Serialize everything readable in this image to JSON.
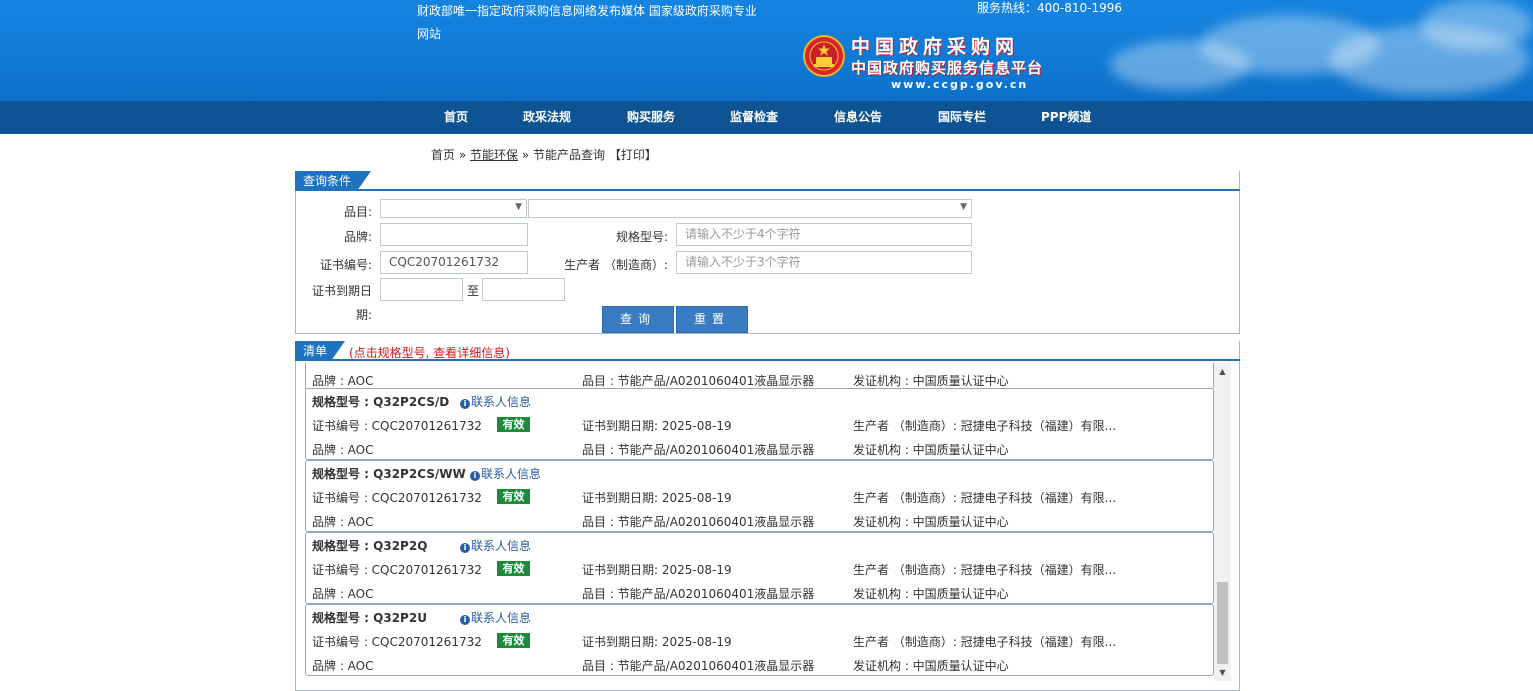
{
  "header": {
    "tagline": "财政部唯一指定政府采购信息网络发布媒体 国家级政府采购专业网站",
    "hotline": "服务热线：400-810-1996",
    "logo_cn_line1": "中国政府采购网",
    "logo_cn_line2": "中国政府购买服务信息平台",
    "logo_url": "www.ccgp.gov.cn"
  },
  "nav": {
    "items": [
      "首页",
      "政采法规",
      "购买服务",
      "监督检查",
      "信息公告",
      "国际专栏",
      "PPP频道"
    ]
  },
  "breadcrumb": {
    "home": "首页",
    "sep1": "»",
    "section": "节能环保",
    "sep2": "»",
    "page": "节能产品查询",
    "print": "【打印】"
  },
  "query": {
    "tab": "查询条件",
    "category_label": "品目:",
    "brand_label": "品牌:",
    "brand_value": "",
    "model_label": "规格型号:",
    "model_placeholder": "请输入不少于4个字符",
    "cert_label": "证书编号:",
    "cert_value": "CQC20701261732",
    "maker_label": "生产者 （制造商）:",
    "maker_placeholder": "请输入不少于3个字符",
    "expiry_label_1": "证书到期日",
    "expiry_label_2": "期:",
    "to_label": "至",
    "search_button": "查询",
    "reset_button": "重置"
  },
  "list": {
    "tab": "清单",
    "hint": "(点击规格型号, 查看详细信息)",
    "contact_label": "联系人信息",
    "partial_row": {
      "brand": "品牌 : AOC",
      "category": "品目 : 节能产品/A0201060401液晶显示器",
      "issuer": "发证机构 : 中国质量认证中心"
    },
    "items": [
      {
        "model": "规格型号 : Q32P2CS/D",
        "cert": "证书编号 : CQC20701261732",
        "status": "有效",
        "expiry": "证书到期日期: 2025-08-19",
        "maker": "生产者 （制造商）: 冠捷电子科技（福建）有限...",
        "brand": "品牌 : AOC",
        "category": "品目 : 节能产品/A0201060401液晶显示器",
        "issuer": "发证机构 : 中国质量认证中心"
      },
      {
        "model": "规格型号 : Q32P2CS/WW",
        "cert": "证书编号 : CQC20701261732",
        "status": "有效",
        "expiry": "证书到期日期: 2025-08-19",
        "maker": "生产者 （制造商）: 冠捷电子科技（福建）有限...",
        "brand": "品牌 : AOC",
        "category": "品目 : 节能产品/A0201060401液晶显示器",
        "issuer": "发证机构 : 中国质量认证中心"
      },
      {
        "model": "规格型号 : Q32P2Q",
        "cert": "证书编号 : CQC20701261732",
        "status": "有效",
        "expiry": "证书到期日期: 2025-08-19",
        "maker": "生产者 （制造商）: 冠捷电子科技（福建）有限...",
        "brand": "品牌 : AOC",
        "category": "品目 : 节能产品/A0201060401液晶显示器",
        "issuer": "发证机构 : 中国质量认证中心"
      },
      {
        "model": "规格型号 : Q32P2U",
        "cert": "证书编号 : CQC20701261732",
        "status": "有效",
        "expiry": "证书到期日期: 2025-08-19",
        "maker": "生产者 （制造商）: 冠捷电子科技（福建）有限...",
        "brand": "品牌 : AOC",
        "category": "品目 : 节能产品/A0201060401液晶显示器",
        "issuer": "发证机构 : 中国质量认证中心"
      }
    ]
  },
  "icons": {
    "emblem": "national-emblem-icon",
    "info": "info-circle-icon",
    "scroll_up": "scroll-up-arrow-icon",
    "scroll_down": "scroll-down-arrow-icon",
    "select_caret": "chevron-down-icon"
  },
  "colors": {
    "header_blue": "#1584e0",
    "nav_blue": "#0e5394",
    "tab_blue": "#1d72c2",
    "valid_green": "#1c8c3c",
    "hint_red": "#d01818"
  }
}
